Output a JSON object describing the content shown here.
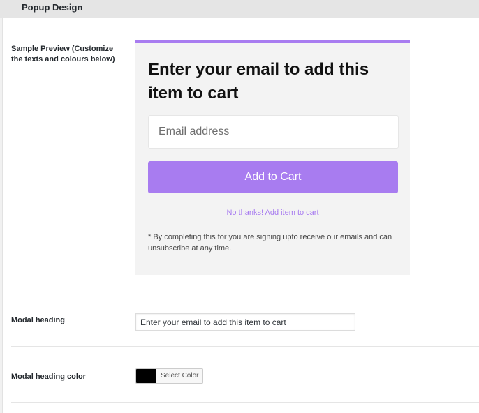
{
  "header": {
    "title": "Popup Design"
  },
  "sample_preview": {
    "label": "Sample Preview (Customize the texts and colours below)",
    "heading": "Enter your email to add this item to cart",
    "email_placeholder": "Email address",
    "cta_label": "Add to Cart",
    "no_thanks": "No thanks! Add item to cart",
    "disclaimer": "* By completing this for you are signing upto receive our emails and can unsubscribe at any time.",
    "accent_color": "#a87cf0"
  },
  "modal_heading": {
    "label": "Modal heading",
    "value": "Enter your email to add this item to cart"
  },
  "modal_heading_color": {
    "label": "Modal heading color",
    "value": "#000000",
    "button_label": "Select Color"
  }
}
